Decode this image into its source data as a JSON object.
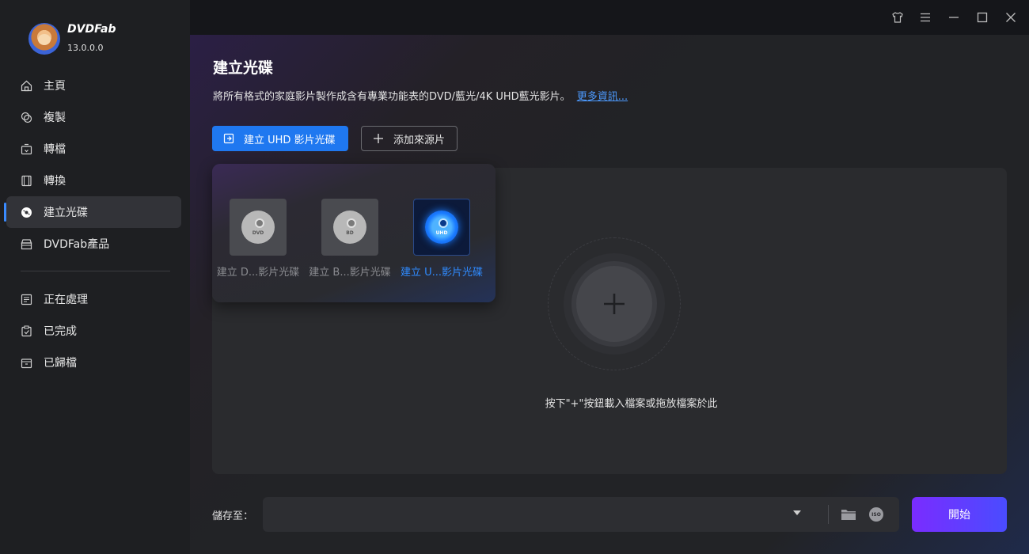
{
  "app": {
    "brand": "DVDFab",
    "version": "13.0.0.0"
  },
  "sidebar": {
    "items": [
      {
        "label": "主頁",
        "icon": "home-icon"
      },
      {
        "label": "複製",
        "icon": "copy-icon"
      },
      {
        "label": "轉檔",
        "icon": "rip-icon"
      },
      {
        "label": "轉換",
        "icon": "convert-icon"
      },
      {
        "label": "建立光碟",
        "icon": "disc-icon",
        "active": true
      },
      {
        "label": "DVDFab產品",
        "icon": "products-icon"
      }
    ],
    "tasks": [
      {
        "label": "正在處理",
        "icon": "processing-icon"
      },
      {
        "label": "已完成",
        "icon": "completed-icon"
      },
      {
        "label": "已歸檔",
        "icon": "archived-icon"
      }
    ]
  },
  "main": {
    "title": "建立光碟",
    "description": "將所有格式的家庭影片製作成含有專業功能表的DVD/藍光/4K UHD藍光影片。",
    "more_link": "更多資訊...",
    "primary_button": "建立 UHD 影片光碟",
    "add_source_button": "添加來源片",
    "disc_options": [
      {
        "label": "建立 D...影片光碟",
        "tag": "DVD"
      },
      {
        "label": "建立 B...影片光碟",
        "tag": "BD"
      },
      {
        "label": "建立 U...影片光碟",
        "tag": "UHD",
        "selected": true
      }
    ],
    "drop_hint": "按下\"+\"按鈕載入檔案或拖放檔案於此",
    "save_to_label": "儲存至：",
    "iso_label": "ISO",
    "start_button": "開始"
  },
  "colors": {
    "accent_blue": "#1f78f0",
    "link_blue": "#4d9bff",
    "start_gradient_start": "#7a2cff",
    "start_gradient_end": "#4a4cff"
  }
}
